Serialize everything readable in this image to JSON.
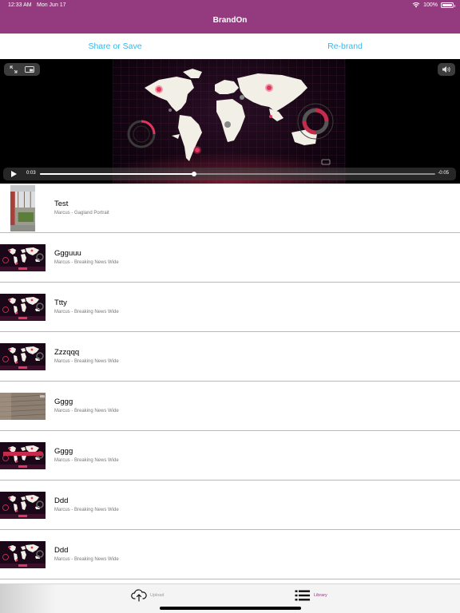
{
  "status": {
    "time": "12:33 AM",
    "date": "Mon Jun 17",
    "battery": "100%",
    "battery_level": 1.0
  },
  "nav": {
    "title": "BrandOn"
  },
  "actions": {
    "share": "Share or Save",
    "rebrand": "Re-brand"
  },
  "player": {
    "current_time": "0:03",
    "remaining_time": "-0:05",
    "progress": 0.39
  },
  "library": [
    {
      "title": "Test",
      "subtitle": "Marcus - Gagland Portrait",
      "thumb": "building"
    },
    {
      "title": "Ggguuu",
      "subtitle": "Marcus - Breaking News Wide",
      "thumb": "map"
    },
    {
      "title": "Ttty",
      "subtitle": "Marcus - Breaking News Wide",
      "thumb": "map"
    },
    {
      "title": "Zzzqqq",
      "subtitle": "Marcus - Breaking News Wide",
      "thumb": "map"
    },
    {
      "title": "Gggg",
      "subtitle": "Marcus - Breaking News Wide",
      "thumb": "wall"
    },
    {
      "title": "Gggg",
      "subtitle": "Marcus - Breaking News Wide",
      "thumb": "map-banner"
    },
    {
      "title": "Ddd",
      "subtitle": "Marcus - Breaking News Wide",
      "thumb": "map"
    },
    {
      "title": "Ddd",
      "subtitle": "Marcus - Breaking News Wide",
      "thumb": "map"
    }
  ],
  "tabs": [
    {
      "label": "Upload",
      "icon": "cloud-upload-icon",
      "color": "#9a9a9a"
    },
    {
      "label": "Library",
      "icon": "list-icon",
      "color": "#943b7f",
      "selected": true
    }
  ],
  "colors": {
    "brand": "#943b7f",
    "accent": "#3ab6ea",
    "map_land": "#f1efe6",
    "marker": "#e5335e"
  }
}
